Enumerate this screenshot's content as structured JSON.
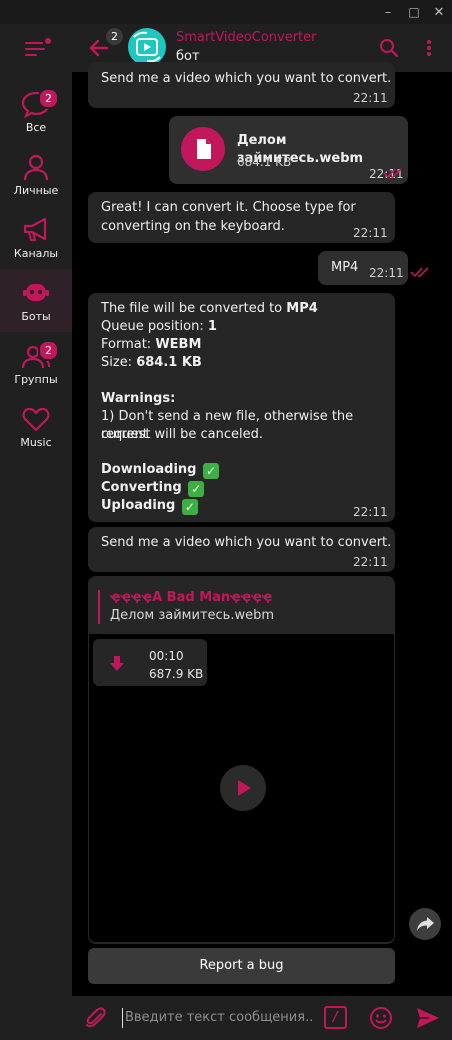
{
  "window": {
    "minimize": "–",
    "maximize": "□",
    "close": "✕"
  },
  "colors": {
    "accent": "#c2185b",
    "sidebar_bg": "#202020",
    "bubble_bg": "#262626",
    "avatar_bg": "#1ec8c0"
  },
  "sidebar": {
    "folders": [
      {
        "label": "Все",
        "icon": "chat-bubble-icon",
        "badge": "2"
      },
      {
        "label": "Личные",
        "icon": "person-icon",
        "badge": ""
      },
      {
        "label": "Каналы",
        "icon": "megaphone-icon",
        "badge": ""
      },
      {
        "label": "Боты",
        "icon": "robot-icon",
        "badge": "",
        "active": true
      },
      {
        "label": "Группы",
        "icon": "group-icon",
        "badge": "2"
      },
      {
        "label": "Music",
        "icon": "heart-icon",
        "badge": ""
      }
    ]
  },
  "header": {
    "back_badge": "2",
    "title": "SmartVideoConverter",
    "subtitle": "бот"
  },
  "messages": {
    "m1": {
      "text": "Send me a video which you want to convert.",
      "time": "22:11"
    },
    "m2": {
      "file_name": "Делом займитесь.webm",
      "file_size": "684.1 KB",
      "time": "22:11"
    },
    "m3": {
      "line1": "Great! I can convert it. Choose type for",
      "line2": "converting on the keyboard.",
      "time": "22:11"
    },
    "m4": {
      "text": "MP4",
      "time": "22:11"
    },
    "m5": {
      "l1_pre": "The file will be converted to ",
      "l1_bold": "MP4",
      "l2_pre": "Queue position: ",
      "l2_bold": "1",
      "l3_pre": "Format: ",
      "l3_bold": "WEBM",
      "l4_pre": "Size: ",
      "l4_bold": "684.1 KB",
      "warnings": "Warnings:",
      "w1": "1) Don't send a new file, otherwise the current",
      "w2": "request will be canceled.",
      "s1": "Downloading",
      "s2": "Converting",
      "s3": "Uploading",
      "check": "✓",
      "time": "22:11"
    },
    "m6": {
      "text": "Send me a video which you want to convert.",
      "time": "22:11"
    },
    "m7": {
      "reply_author": "ҿҿҿҿA Bad Manҿҿҿҿ",
      "reply_text": "Делом займитесь.webm"
    },
    "m8": {
      "duration": "00:10",
      "size": "687.9 KB"
    }
  },
  "report_button": "Report a bug",
  "composer": {
    "placeholder": "Введите текст сообщения...",
    "slash": "/"
  }
}
